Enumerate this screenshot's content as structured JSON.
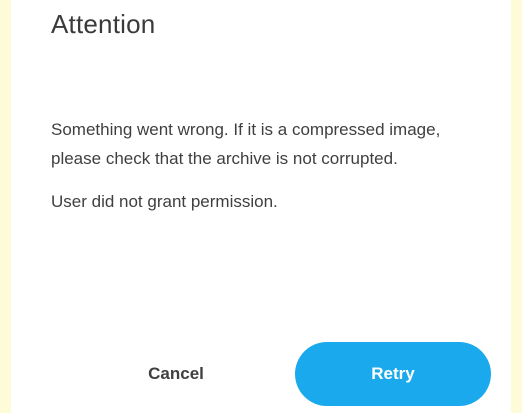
{
  "dialog": {
    "title": "Attention",
    "message": "Something went wrong. If it is a compressed image, please check that the archive is not corrupted.",
    "detail": "User did not grant permission.",
    "cancel_label": "Cancel",
    "retry_label": "Retry"
  },
  "colors": {
    "page_background": "#fdfbd8",
    "dialog_background": "#ffffff",
    "primary_button": "#1aa9ec",
    "primary_button_text": "#ffffff",
    "text": "#3f3f3f"
  }
}
